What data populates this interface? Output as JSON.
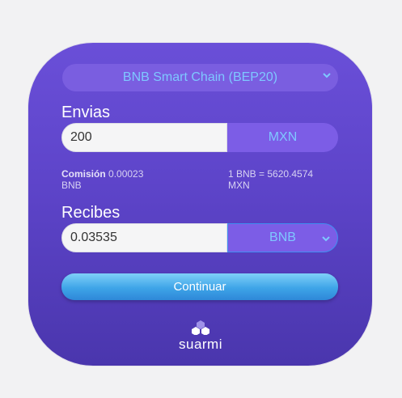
{
  "network": {
    "label": "BNB Smart Chain (BEP20)"
  },
  "send": {
    "label": "Envias",
    "amount": "200",
    "currency": "MXN"
  },
  "fee": {
    "label": "Comisión",
    "value": "0.00023",
    "unit": "BNB"
  },
  "rate": {
    "text": "1 BNB = 5620.4574",
    "unit": "MXN"
  },
  "receive": {
    "label": "Recibes",
    "amount": "0.03535",
    "currency": "BNB"
  },
  "continue_button": {
    "label": "Continuar"
  },
  "brand": {
    "name": "suarmi"
  },
  "colors": {
    "card": "#5d44c9",
    "accent_text": "#7ec8ff",
    "button": "#3ea4e8"
  },
  "icons": {
    "dropdown": "chevron-down-icon",
    "logo": "hexagon-cluster-icon"
  }
}
